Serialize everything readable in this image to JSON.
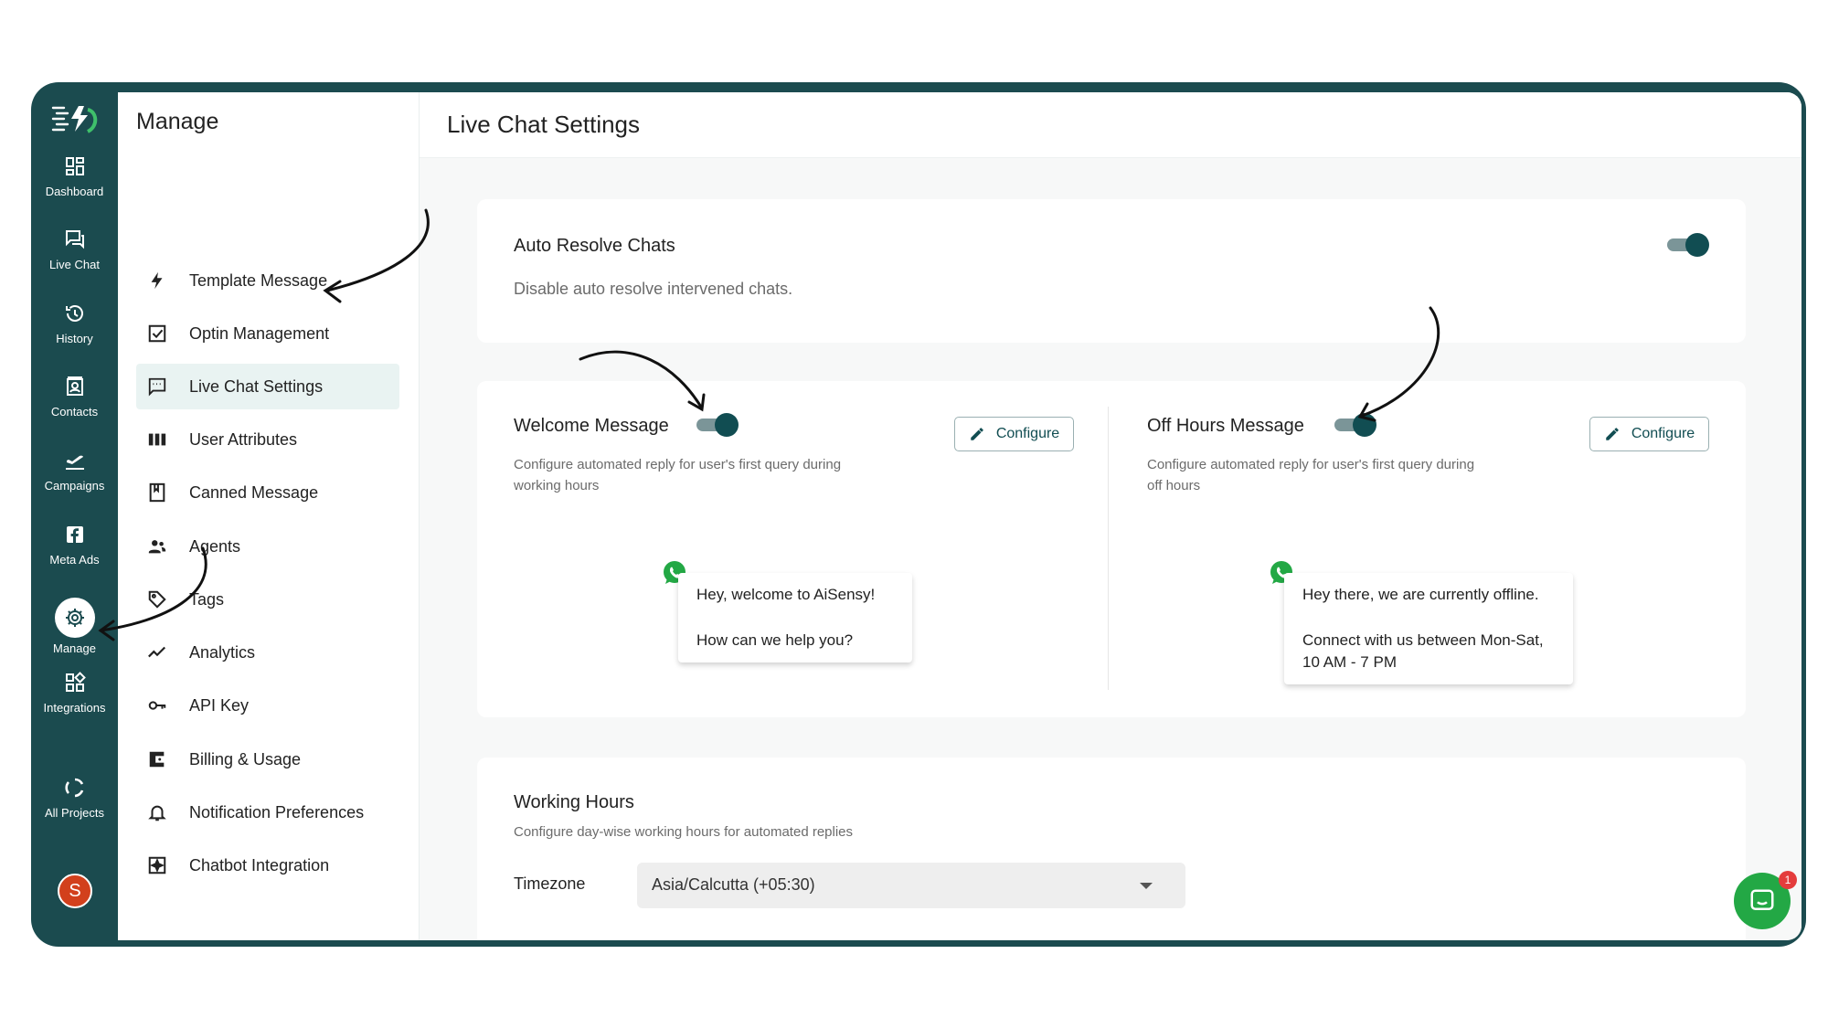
{
  "rail": {
    "items": [
      {
        "label": "Dashboard",
        "icon": "dashboard-icon"
      },
      {
        "label": "Live Chat",
        "icon": "chat-icon"
      },
      {
        "label": "History",
        "icon": "history-icon"
      },
      {
        "label": "Contacts",
        "icon": "contacts-icon"
      },
      {
        "label": "Campaigns",
        "icon": "campaigns-icon"
      },
      {
        "label": "Meta Ads",
        "icon": "facebook-icon"
      },
      {
        "label": "Manage",
        "icon": "gear-icon",
        "active": true
      },
      {
        "label": "Integrations",
        "icon": "integrations-icon"
      },
      {
        "label": "All Projects",
        "icon": "projects-icon"
      }
    ],
    "avatar_initial": "S"
  },
  "manage": {
    "title": "Manage",
    "items": [
      {
        "label": "Template Message",
        "icon": "lightning-icon"
      },
      {
        "label": "Optin Management",
        "icon": "checkbox-icon"
      },
      {
        "label": "Live Chat Settings",
        "icon": "message-icon",
        "active": true
      },
      {
        "label": "User Attributes",
        "icon": "columns-icon"
      },
      {
        "label": "Canned Message",
        "icon": "bookmark-icon"
      },
      {
        "label": "Agents",
        "icon": "agents-icon"
      },
      {
        "label": "Tags",
        "icon": "tag-icon"
      },
      {
        "label": "Analytics",
        "icon": "trend-icon"
      },
      {
        "label": "API Key",
        "icon": "key-icon"
      },
      {
        "label": "Billing & Usage",
        "icon": "wallet-icon"
      },
      {
        "label": "Notification Preferences",
        "icon": "bell-icon"
      },
      {
        "label": "Chatbot Integration",
        "icon": "chatbot-icon"
      }
    ]
  },
  "page": {
    "title": "Live Chat Settings",
    "auto_resolve": {
      "title": "Auto Resolve Chats",
      "description": "Disable auto resolve intervened chats.",
      "enabled": true
    },
    "welcome": {
      "title": "Welcome Message",
      "enabled": true,
      "description": "Configure automated reply for user's first query during working hours",
      "configure_label": "Configure",
      "preview": {
        "line1": "Hey, welcome to AiSensy!",
        "line2": "How can we help you?"
      }
    },
    "off_hours": {
      "title": "Off Hours Message",
      "enabled": true,
      "description": "Configure automated reply for user's first query during off hours",
      "configure_label": "Configure",
      "preview": {
        "line1": "Hey there, we are currently offline.",
        "line2": "Connect with us between Mon-Sat, 10 AM - 7 PM"
      }
    },
    "working_hours": {
      "title": "Working Hours",
      "description": "Configure day-wise working hours for automated replies",
      "timezone_label": "Timezone",
      "timezone_value": "Asia/Calcutta (+05:30)"
    }
  },
  "chat_widget": {
    "badge": "1"
  },
  "colors": {
    "brand_dark": "#1b4b4f",
    "toggle_on": "#114d52",
    "whatsapp": "#23a845",
    "active_menu_bg": "#e9f3f2"
  }
}
